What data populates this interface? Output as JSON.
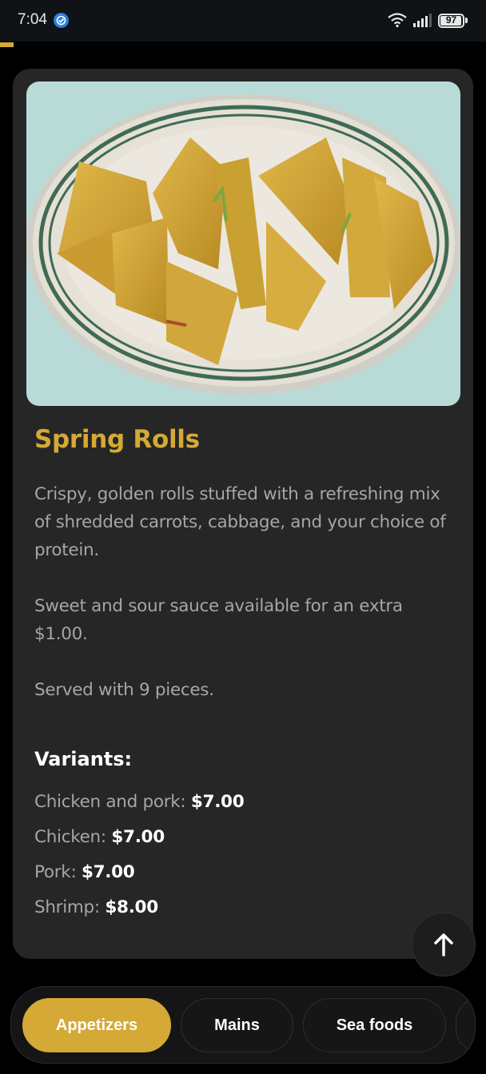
{
  "status_bar": {
    "time": "7:04",
    "battery": "97",
    "battery_level": 0.97
  },
  "item": {
    "title": "Spring Rolls",
    "description": [
      "Crispy, golden rolls stuffed with a refreshing mix of shredded carrots, cabbage, and your choice of protein.",
      "Sweet and sour sauce available for an extra $1.00.",
      "Served with 9 pieces."
    ],
    "variants_heading": "Variants:",
    "variants": [
      {
        "name": "Chicken and pork:",
        "price": "$7.00"
      },
      {
        "name": "Chicken:",
        "price": "$7.00"
      },
      {
        "name": "Pork:",
        "price": "$7.00"
      },
      {
        "name": "Shrimp:",
        "price": "$8.00"
      }
    ]
  },
  "scroll_top_icon": "arrow-up-icon",
  "categories": [
    {
      "label": "Appetizers",
      "active": true
    },
    {
      "label": "Mains",
      "active": false
    },
    {
      "label": "Sea foods",
      "active": false
    },
    {
      "label": "",
      "active": false
    }
  ],
  "colors": {
    "accent": "#d4a935",
    "card": "#262626",
    "background": "#000000"
  }
}
